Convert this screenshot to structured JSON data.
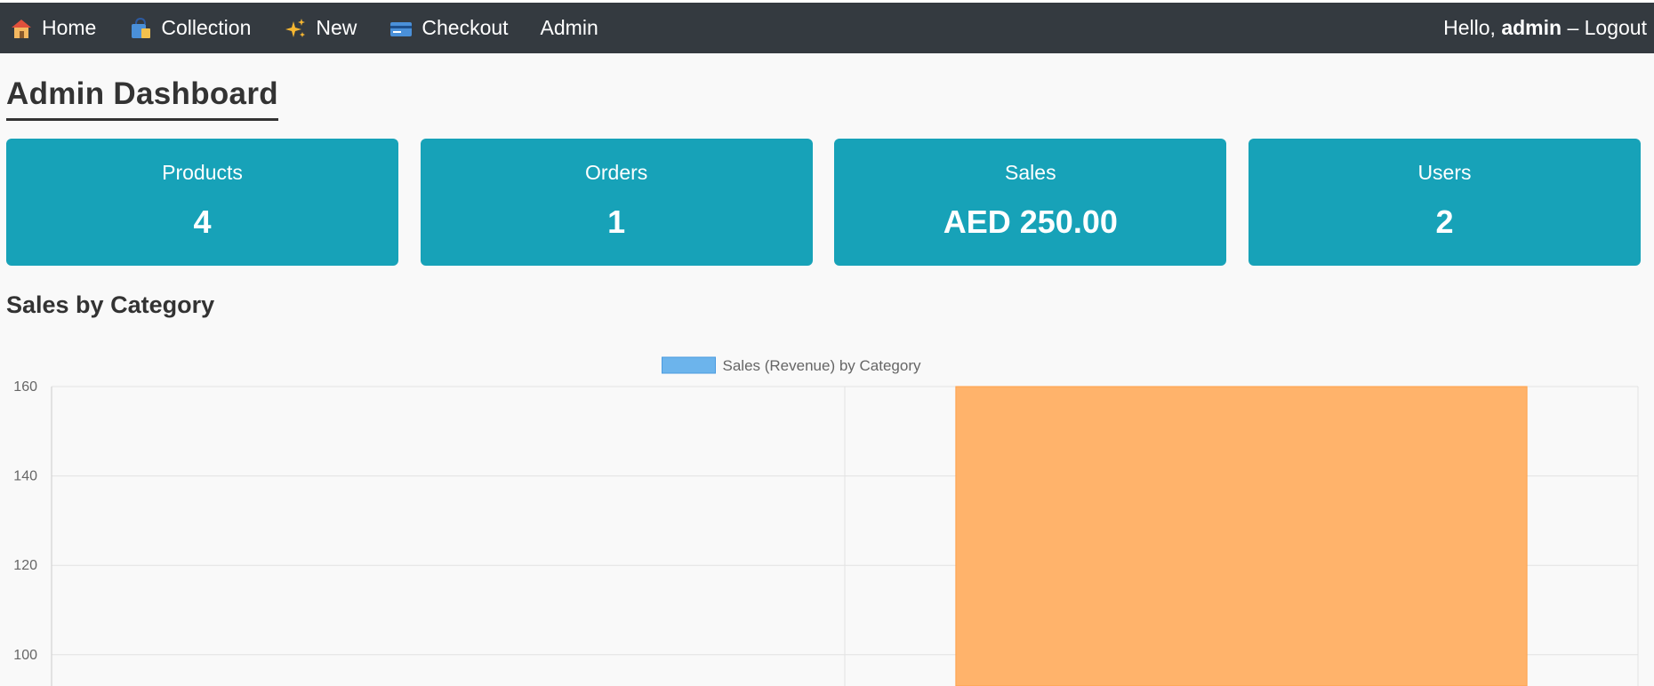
{
  "navbar": {
    "items": [
      {
        "label": "Home",
        "icon": "house-icon"
      },
      {
        "label": "Collection",
        "icon": "shopping-bags-icon"
      },
      {
        "label": "New",
        "icon": "sparkles-icon"
      },
      {
        "label": "Checkout",
        "icon": "credit-card-icon"
      },
      {
        "label": "Admin",
        "icon": ""
      }
    ],
    "greeting": "Hello,",
    "username": "admin",
    "separator": "–",
    "logout": "Logout"
  },
  "page": {
    "title": "Admin Dashboard"
  },
  "stats": [
    {
      "label": "Products",
      "value": "4"
    },
    {
      "label": "Orders",
      "value": "1"
    },
    {
      "label": "Sales",
      "value": "AED 250.00"
    },
    {
      "label": "Users",
      "value": "2"
    }
  ],
  "section": {
    "title": "Sales by Category"
  },
  "colors": {
    "navbar_bg": "#343a40",
    "card_bg": "#17a2b8",
    "bar_orange": "#ffb36b",
    "legend_blue": "#6cb4ec"
  },
  "chart_data": {
    "type": "bar",
    "legend": [
      "Sales (Revenue) by Category"
    ],
    "categories": [
      "",
      ""
    ],
    "series": [
      {
        "name": "Sales (Revenue) by Category",
        "values": [
          null,
          160
        ]
      }
    ],
    "ylim": [
      93,
      160
    ],
    "yticks": [
      160,
      140,
      120,
      100
    ],
    "grid": true,
    "legend_position": "top"
  }
}
